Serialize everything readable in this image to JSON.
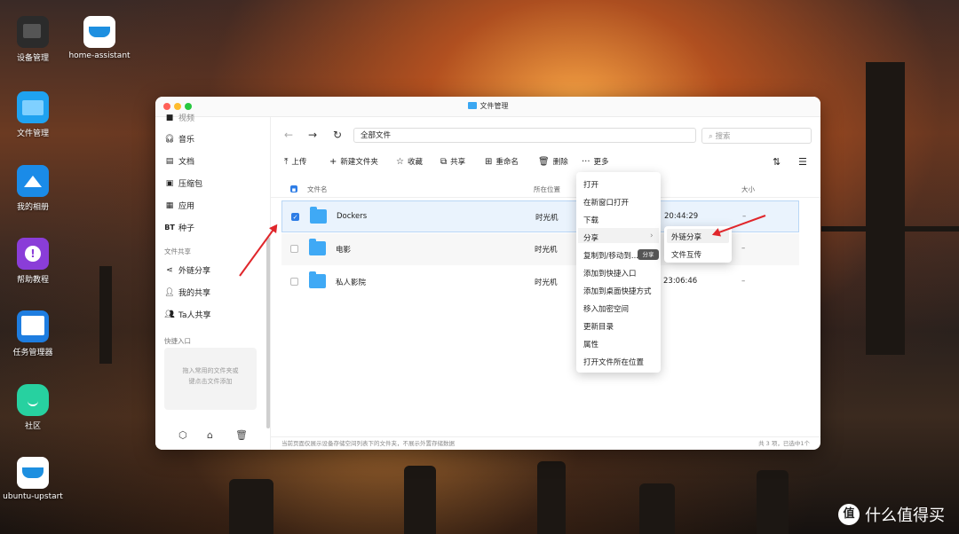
{
  "desktop": {
    "icons": [
      {
        "label": "设备管理"
      },
      {
        "label": "home-assistant"
      },
      {
        "label": "文件管理"
      },
      {
        "label": "我的相册"
      },
      {
        "label": "帮助教程"
      },
      {
        "label": "任务管理器"
      },
      {
        "label": "社区"
      },
      {
        "label": "ubuntu-upstart"
      }
    ]
  },
  "window": {
    "title": "文件管理",
    "colors": {
      "accent": "#2e7de6",
      "folder": "#3fa9f5",
      "close": "#ff5f57",
      "minimize": "#febc2e",
      "maximize": "#28c840"
    }
  },
  "sidebar": {
    "items": [
      {
        "label": "视频",
        "icon": "video-icon"
      },
      {
        "label": "音乐",
        "icon": "headphones-icon"
      },
      {
        "label": "文档",
        "icon": "document-icon"
      },
      {
        "label": "压缩包",
        "icon": "archive-icon"
      },
      {
        "label": "应用",
        "icon": "apps-icon"
      },
      {
        "label": "种子",
        "icon": "bt-icon"
      }
    ],
    "share_heading": "文件共享",
    "share_items": [
      {
        "label": "外链分享",
        "icon": "share-icon"
      },
      {
        "label": "我的共享",
        "icon": "my-share-icon"
      },
      {
        "label": "Ta人共享",
        "icon": "others-share-icon"
      }
    ],
    "quick_heading": "快捷入口",
    "drop_hint_line1": "拖入常用的文件夹或",
    "drop_hint_line2": "键点击文件添加",
    "bt_badge": "BT"
  },
  "toolbar": {
    "path": "全部文件",
    "search_placeholder": "搜索",
    "upload": "上传",
    "new_folder": "新建文件夹",
    "favorite": "收藏",
    "share": "共享",
    "rename": "重命名",
    "delete": "删除",
    "more": "更多"
  },
  "list": {
    "headers": {
      "name": "文件名",
      "location": "所在位置",
      "size": "大小"
    },
    "rows": [
      {
        "name": "Dockers",
        "location": "时光机",
        "time": "20:44:29",
        "size": "–",
        "selected": true
      },
      {
        "name": "电影",
        "location": "时光机",
        "time": "",
        "size": "–",
        "selected": false
      },
      {
        "name": "私人影院",
        "location": "时光机",
        "time": "23:06:46",
        "size": "–",
        "selected": false
      }
    ]
  },
  "status": {
    "left": "当前页面仅展示设备存储空间列表下的文件夹，不展示外置存储数据",
    "right": "共 3 项，已选中1个"
  },
  "context_menu": {
    "items": [
      "打开",
      "在新窗口打开",
      "下载",
      "分享",
      "复制到/移动到...",
      "添加到快捷入口",
      "添加到桌面快捷方式",
      "移入加密空间",
      "更新目录",
      "属性",
      "打开文件所在位置"
    ],
    "tooltip": "分享"
  },
  "submenu": {
    "items": [
      "外链分享",
      "文件互传"
    ]
  },
  "watermark": {
    "text": "什么值得买",
    "icon_text": "值"
  }
}
